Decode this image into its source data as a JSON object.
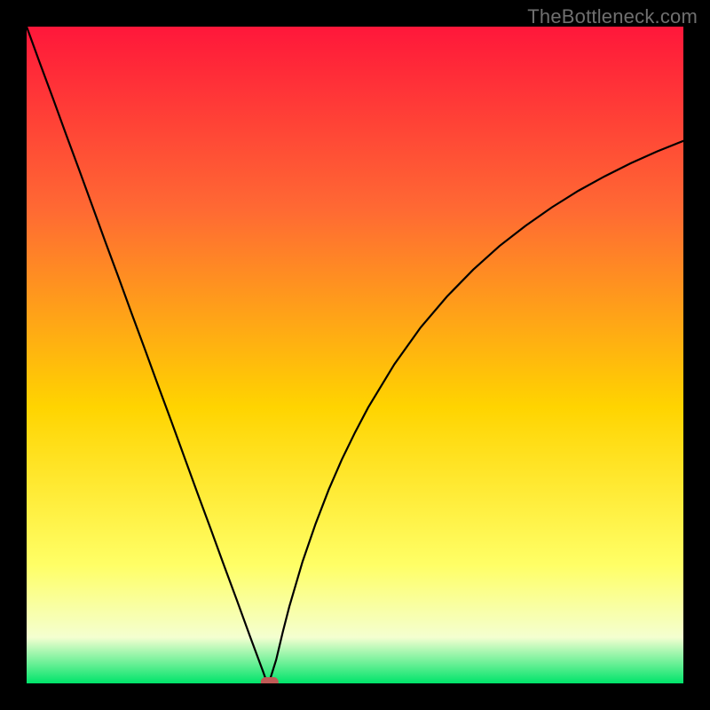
{
  "watermark": "TheBottleneck.com",
  "gradient": {
    "top": "#ff173a",
    "mid_upper": "#ff6a33",
    "mid": "#ffd400",
    "lower_yellow": "#ffff66",
    "pale": "#f4ffd0",
    "green": "#00e46a"
  },
  "chart_data": {
    "type": "line",
    "title": "",
    "xlabel": "",
    "ylabel": "",
    "xlim": [
      0,
      100
    ],
    "ylim": [
      0,
      100
    ],
    "x": [
      0,
      2,
      4,
      6,
      8,
      10,
      12,
      14,
      16,
      18,
      20,
      22,
      24,
      26,
      28,
      30,
      32,
      34,
      36,
      36.5,
      37,
      38,
      39,
      40,
      42,
      44,
      46,
      48,
      50,
      52,
      56,
      60,
      64,
      68,
      72,
      76,
      80,
      84,
      88,
      92,
      96,
      100
    ],
    "y": [
      100,
      94.5,
      89.1,
      83.6,
      78.2,
      72.7,
      67.2,
      61.8,
      56.3,
      50.9,
      45.4,
      40.0,
      34.5,
      29.0,
      23.6,
      18.1,
      12.7,
      7.2,
      1.8,
      0.4,
      0.4,
      3.6,
      7.8,
      11.7,
      18.5,
      24.3,
      29.5,
      34.1,
      38.2,
      42.0,
      48.6,
      54.2,
      58.9,
      63.0,
      66.6,
      69.7,
      72.5,
      75.0,
      77.2,
      79.2,
      81.0,
      82.6
    ],
    "marker": {
      "x": 37,
      "y": 0.2,
      "color": "#c05a56"
    }
  }
}
